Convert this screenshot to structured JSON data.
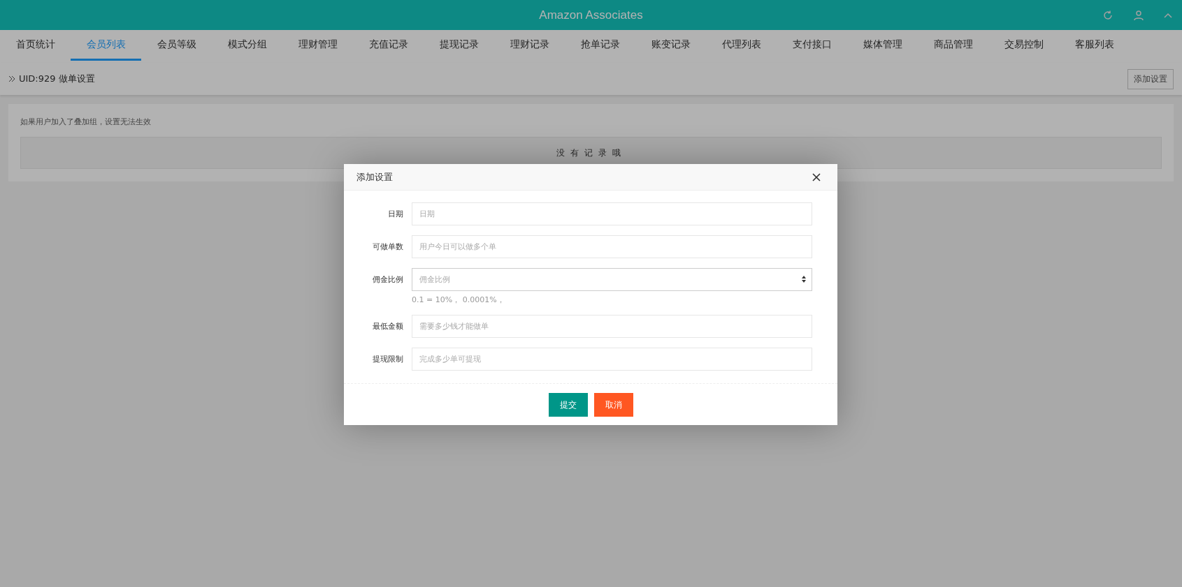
{
  "header": {
    "title": "Amazon Associates"
  },
  "tabs": [
    {
      "label": "首页统计",
      "selected": false
    },
    {
      "label": "会员列表",
      "selected": true
    },
    {
      "label": "会员等级",
      "selected": false
    },
    {
      "label": "模式分组",
      "selected": false
    },
    {
      "label": "理财管理",
      "selected": false
    },
    {
      "label": "充值记录",
      "selected": false
    },
    {
      "label": "提现记录",
      "selected": false
    },
    {
      "label": "理财记录",
      "selected": false
    },
    {
      "label": "抢单记录",
      "selected": false
    },
    {
      "label": "账变记录",
      "selected": false
    },
    {
      "label": "代理列表",
      "selected": false
    },
    {
      "label": "支付接口",
      "selected": false
    },
    {
      "label": "媒体管理",
      "selected": false
    },
    {
      "label": "商品管理",
      "selected": false
    },
    {
      "label": "交易控制",
      "selected": false
    },
    {
      "label": "客服列表",
      "selected": false
    }
  ],
  "breadcrumb": {
    "text": "UID:929 做单设置",
    "button": "添加设置"
  },
  "card": {
    "note": "如果用户加入了叠加组，设置无法生效",
    "empty": "没有记录哦"
  },
  "modal": {
    "title": "添加设置",
    "fields": [
      {
        "label": "日期",
        "placeholder": "日期",
        "kind": "text"
      },
      {
        "label": "可做单数",
        "placeholder": "用户今日可以做多个单",
        "kind": "text"
      },
      {
        "label": "佣金比例",
        "placeholder": "佣金比例",
        "kind": "number",
        "hint": "0.1 = 10%， 0.0001%，"
      },
      {
        "label": "最低金额",
        "placeholder": "需要多少钱才能做单",
        "kind": "text"
      },
      {
        "label": "提现限制",
        "placeholder": "完成多少单可提现",
        "kind": "text"
      }
    ],
    "buttons": [
      {
        "label": "提交",
        "kind": "primary"
      },
      {
        "label": "取消",
        "kind": "danger"
      }
    ]
  }
}
